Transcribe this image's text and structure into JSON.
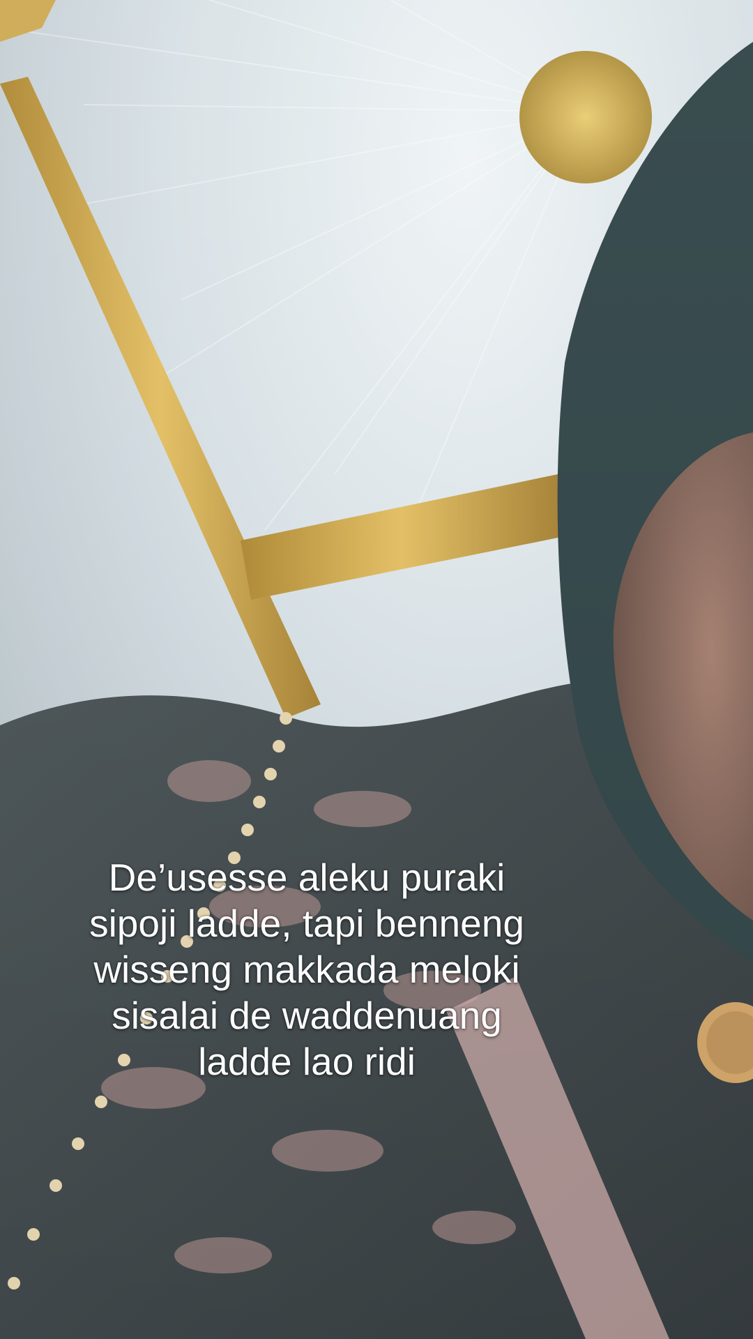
{
  "caption": {
    "lines": [
      "De’usesse aleku puraki",
      "sipoji ladde, tapi benneng",
      "wisseng makkada meloki",
      "sisalai de waddenuang",
      "ladde lao ridi"
    ]
  },
  "colors": {
    "ceiling_fabric": "#dfe6ea",
    "gold_trim": "#c9a245",
    "hijab": "#1f3437",
    "batik_dark": "#2c3336",
    "batik_pink": "#b08a86",
    "skin": "#8f6b5c",
    "caption_text": "#ffffff"
  }
}
